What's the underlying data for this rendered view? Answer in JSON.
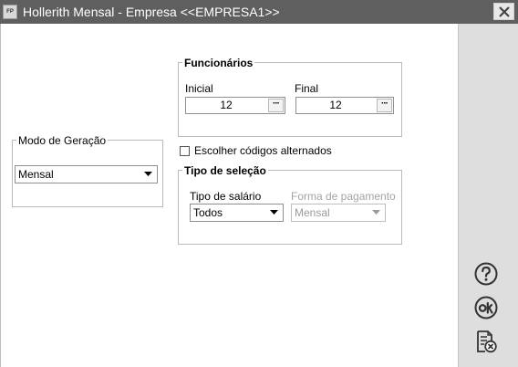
{
  "window": {
    "app_icon_text": "FP",
    "title": "Hollerith Mensal - Empresa <<EMPRESA1>>"
  },
  "modo_geracao": {
    "title": "Modo de Geração",
    "selected": "Mensal"
  },
  "funcionarios": {
    "title": "Funcionários",
    "inicial_label": "Inicial",
    "inicial_value": "12",
    "final_label": "Final",
    "final_value": "12",
    "picker_dots": "···"
  },
  "escolher_codigos": {
    "label": "Escolher códigos alternados",
    "checked": false
  },
  "tipo_selecao": {
    "title": "Tipo de seleção",
    "tipo_salario_label": "Tipo de salário",
    "tipo_salario_value": "Todos",
    "forma_pagamento_label": "Forma de pagamento",
    "forma_pagamento_value": "Mensal"
  },
  "side_actions": {
    "help_icon": "question-circle",
    "ok_icon": "ok-circle",
    "cancel_icon": "document-cancel"
  }
}
